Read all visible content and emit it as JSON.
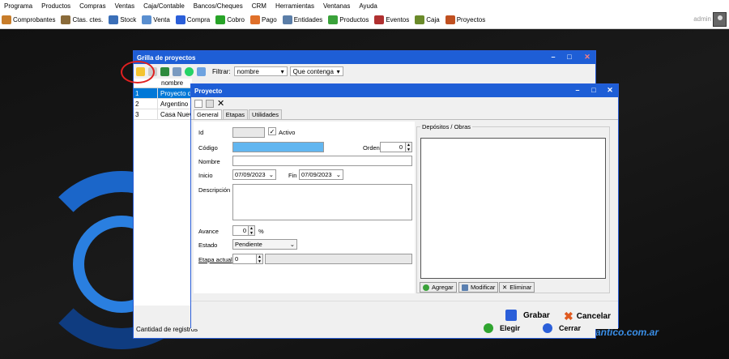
{
  "menu": [
    "Programa",
    "Productos",
    "Compras",
    "Ventas",
    "Caja/Contable",
    "Bancos/Cheques",
    "CRM",
    "Herramientas",
    "Ventanas",
    "Ayuda"
  ],
  "toolbar": [
    {
      "label": "Comprobantes",
      "color": "#c87d2a"
    },
    {
      "label": "Ctas. ctes.",
      "color": "#8a6b3a"
    },
    {
      "label": "Stock",
      "color": "#3b6fb8"
    },
    {
      "label": "Venta",
      "color": "#5a8fd0"
    },
    {
      "label": "Compra",
      "color": "#2b5fd9"
    },
    {
      "label": "Cobro",
      "color": "#28a428"
    },
    {
      "label": "Pago",
      "color": "#e0702a"
    },
    {
      "label": "Entidades",
      "color": "#5b7ea8"
    },
    {
      "label": "Productos",
      "color": "#3aa23a"
    },
    {
      "label": "Eventos",
      "color": "#b03030"
    },
    {
      "label": "Caja",
      "color": "#6a8a2a"
    },
    {
      "label": "Proyectos",
      "color": "#c05020"
    }
  ],
  "user": {
    "name": "admin"
  },
  "grid_window": {
    "title": "Grilla de proyectos",
    "filter_label": "Filtrar:",
    "filter_field": "nombre",
    "filter_mode": "Que contenga",
    "column_header": "nombre",
    "rows": [
      {
        "id": "1",
        "nombre": "Proyecto de"
      },
      {
        "id": "2",
        "nombre": "Argentino D"
      },
      {
        "id": "3",
        "nombre": "Casa Nuev"
      }
    ],
    "footer": "Cantidad de registros"
  },
  "project_window": {
    "title": "Proyecto",
    "tabs": [
      "General",
      "Etapas",
      "Utilidades"
    ],
    "labels": {
      "id": "Id",
      "activo": "Activo",
      "codigo": "Código",
      "orden": "Orden",
      "nombre": "Nombre",
      "inicio": "Inicio",
      "fin": "Fin",
      "descripcion": "Descripción",
      "avance": "Avance",
      "percent": "%",
      "estado": "Estado",
      "etapa_actual": "Etapa actual"
    },
    "values": {
      "orden": "0",
      "inicio": "07/09/2023",
      "fin": "07/09/2023",
      "avance": "0",
      "estado": "Pendiente",
      "etapa_actual": "0"
    },
    "deps_title": "Depósitos / Obras",
    "buttons": {
      "agregar": "Agregar",
      "modificar": "Modificar",
      "eliminar": "Eliminar"
    },
    "grabar": "Grabar",
    "cancelar": "Cancelar"
  },
  "below_buttons": {
    "elegir": "Elegir",
    "cerrar": "Cerrar"
  },
  "brand": "antico.com.ar"
}
